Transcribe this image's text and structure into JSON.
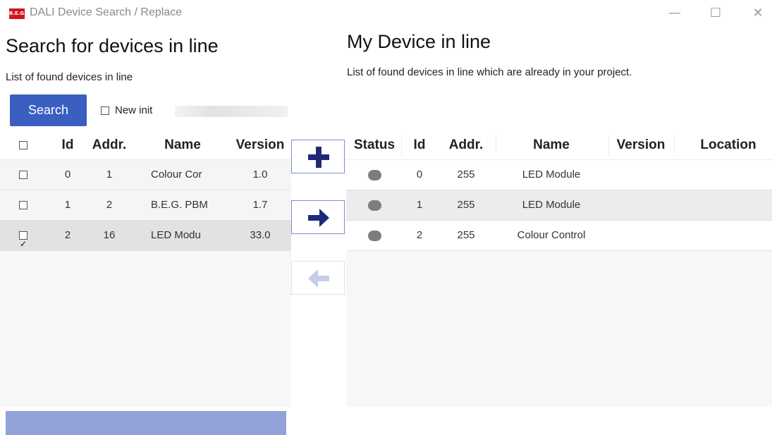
{
  "window": {
    "logo_text": "B.E.G.",
    "title": "DALI Device Search / Replace",
    "minimize": "—",
    "maximize": "☐",
    "close": "✕"
  },
  "left": {
    "title": "Search for devices in line",
    "subtitle": "List of found devices in line",
    "search_label": "Search",
    "new_init_label": "New init",
    "new_init_checked": false,
    "columns": [
      "Id",
      "Addr.",
      "Name",
      "Version"
    ],
    "rows": [
      {
        "checked": false,
        "id": "0",
        "addr": "1",
        "name": "Colour Cor",
        "version": "1.0"
      },
      {
        "checked": false,
        "id": "1",
        "addr": "2",
        "name": "B.E.G. PBM",
        "version": "1.7"
      },
      {
        "checked": true,
        "id": "2",
        "addr": "16",
        "name": "LED Modu",
        "version": "33.0"
      }
    ]
  },
  "middle": {
    "add_icon": "plus-icon",
    "move_icon": "arrow-right-icon",
    "back_icon": "arrow-left-icon"
  },
  "right": {
    "title": "My Device in line",
    "subtitle": "List of found devices in line which are already in your project.",
    "columns": [
      "Status",
      "Id",
      "Addr.",
      "Name",
      "Version",
      "Location"
    ],
    "rows": [
      {
        "status": "gray",
        "id": "0",
        "addr": "255",
        "name": "LED Module",
        "version": "",
        "location": ""
      },
      {
        "status": "gray",
        "id": "1",
        "addr": "255",
        "name": "LED Module",
        "version": "",
        "location": ""
      },
      {
        "status": "gray",
        "id": "2",
        "addr": "255",
        "name": "Colour Control",
        "version": "",
        "location": ""
      }
    ]
  },
  "colors": {
    "accent": "#3a5fc0",
    "icon_navy": "#1e2a78",
    "disabled_icon": "#c5cde8",
    "bottom_bar": "#93a2d8",
    "logo_red": "#d0161e"
  }
}
